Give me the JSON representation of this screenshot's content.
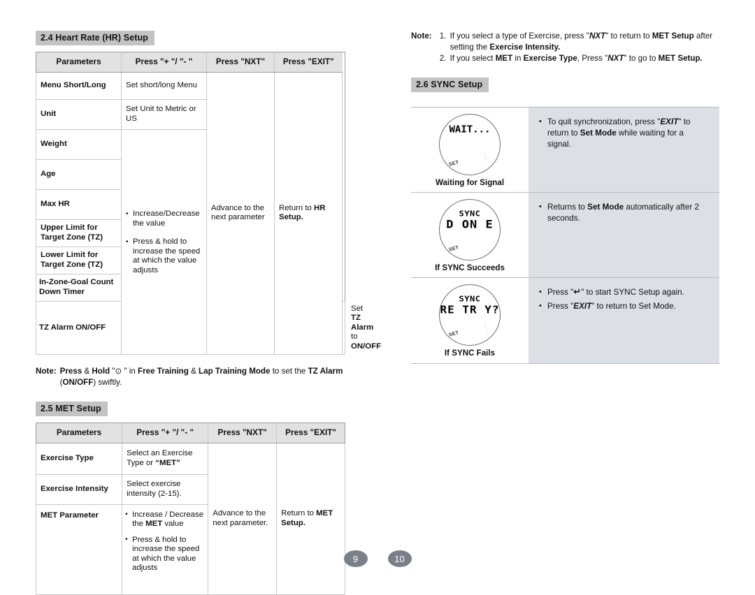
{
  "doc": {
    "page_numbers": [
      "9",
      "10"
    ]
  },
  "hr_setup": {
    "heading": "2.4 Heart Rate (HR) Setup",
    "columns": [
      "Parameters",
      "Press \"+ \"/ \"- \"",
      "Press \"NXT\"",
      "Press \"EXIT\""
    ],
    "rows": [
      {
        "param": "Menu Short/Long",
        "plusminus": "Set short/long Menu"
      },
      {
        "param": "Unit",
        "plusminus": "Set Unit to Metric or US"
      },
      {
        "param": "Weight"
      },
      {
        "param": "Age"
      },
      {
        "param": "Max HR"
      },
      {
        "param": "Upper Limit for Target Zone (TZ)"
      },
      {
        "param": "Lower Limit for Target Zone (TZ)"
      },
      {
        "param": "In-Zone-Goal Count Down Timer"
      },
      {
        "param": "TZ Alarm ON/OFF"
      }
    ],
    "group_plusminus": [
      "Increase/Decrease the value",
      "Press & hold to increase the speed at which the value adjusts"
    ],
    "tz_alarm_plusminus_prefix": "Set ",
    "tz_alarm_plusminus_bold1": "TZ Alarm",
    "tz_alarm_plusminus_mid": " to ",
    "tz_alarm_plusminus_bold2": "ON/OFF",
    "nxt_text": "Advance to the next parameter",
    "exit_prefix": "Return to ",
    "exit_bold": "HR Setup."
  },
  "hr_note": {
    "label": "Note:",
    "p1_b1": "Press",
    "p1_t1": " & ",
    "p1_b2": "Hold",
    "p1_t2": " \"",
    "p1_icon": "⊙",
    "p1_t3": " \" in ",
    "p1_b3": "Free Training",
    "p1_t4": " & ",
    "p1_b4": "Lap Training Mode",
    "p1_t5": " to set the ",
    "p1_b5": "TZ Alarm",
    "p1_t6": " (",
    "p1_b6": "ON/OFF",
    "p1_t7": ") swiftly."
  },
  "met_setup": {
    "heading": "2.5 MET Setup",
    "columns": [
      "Parameters",
      "Press \"+ \"/ \"- \"",
      "Press \"NXT\"",
      "Press \"EXIT\""
    ],
    "rows": [
      {
        "param": "Exercise Type",
        "plusminus_pre": "Select an Exercise Type or ",
        "plusminus_bold": "“MET”"
      },
      {
        "param": "Exercise Intensity",
        "plusminus_pre": "Select exercise intensity (2-15)."
      },
      {
        "param": "MET Parameter"
      }
    ],
    "met_param_bullets_1_pre": "Increase / Decrease the ",
    "met_param_bullets_1_bold": "MET",
    "met_param_bullets_1_post": " value",
    "met_param_bullets_2": "Press & hold to increase the speed at which the value adjusts",
    "nxt_text": "Advance to the next parameter.",
    "exit_prefix": "Return to ",
    "exit_bold": "MET Setup."
  },
  "met_note": {
    "label": "Note:",
    "items": [
      {
        "t1": "If you select a type of Exercise, press \"",
        "bi1": "NXT",
        "t2": "\" to return to ",
        "b1": "MET Setup",
        "t3": " after setting the ",
        "b2": "Exercise Intensity.",
        "t4": ""
      },
      {
        "t1": "If you select ",
        "b0": "MET",
        "t1b": " in ",
        "b0b": "Exercise Type",
        "t2": ", Press \"",
        "bi1": "NXT",
        "t3": "\" to go to ",
        "b1": "MET Setup.",
        "t4": ""
      }
    ]
  },
  "sync_setup": {
    "heading": "2.6 SYNC Setup",
    "rows": [
      {
        "watch": {
          "line_top": "",
          "line_main": "WAIT...",
          "set_label": "SET",
          "marks": "::::"
        },
        "caption": "Waiting for Signal",
        "notes": [
          {
            "t1": "To quit synchronization, press \"",
            "bi1": "EXIT",
            "t2": "\" to return to ",
            "b1": "Set Mode",
            "t3": " while waiting for a signal."
          }
        ]
      },
      {
        "watch": {
          "line_top": "SYNC",
          "line_main": "D ON E",
          "set_label": "SET",
          "marks": ""
        },
        "caption": "If SYNC Succeeds",
        "notes": [
          {
            "t1": "Returns to ",
            "b1": "Set Mode",
            "t3": " automatically after 2 seconds."
          }
        ]
      },
      {
        "watch": {
          "line_top": "SYNC",
          "line_main": "RE TR Y?",
          "set_label": "SET",
          "marks": "::::"
        },
        "caption": "If SYNC Fails",
        "notes": [
          {
            "t1": "Press \"",
            "glyph": "↵",
            "t2": "\" to start SYNC Setup again."
          },
          {
            "t1": "Press \"",
            "bi1": "EXIT",
            "t2": "\" to return to Set Mode."
          }
        ]
      }
    ]
  },
  "colors": {
    "section_badge": "#c3c3c3",
    "table_header": "#e2e2e2",
    "panel_bg": "#dcdfe4",
    "page_badge": "#7b7f87"
  }
}
